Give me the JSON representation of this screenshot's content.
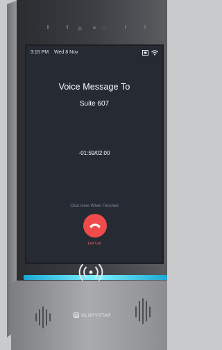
{
  "status_bar": {
    "time": "3:15 PM",
    "date": "Wed 8 Nov",
    "icons": [
      "ethernet-icon",
      "wifi-icon"
    ]
  },
  "call": {
    "title": "Voice Message To",
    "recipient": "Suite 607",
    "timer": "-01:59/02:00",
    "hint": "Click Here When Finished",
    "end_label": "End Call"
  },
  "device": {
    "brand": "GLORYSTAR",
    "rfid_icon": "nfc-icon",
    "led_color": "#3fd6ff",
    "end_call_color": "#f04b4b"
  }
}
